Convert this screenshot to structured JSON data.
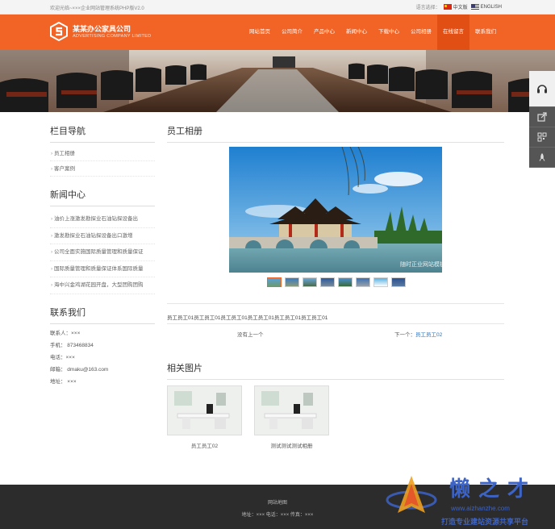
{
  "topbar": {
    "welcome": "欢迎光临~×××企业网站管理系统PHP版V2.0",
    "language_label": "语言选择：",
    "lang_cn": "中文版",
    "lang_en": "ENGLISH"
  },
  "header": {
    "company_name": "某某办公家具公司",
    "company_sub": "ADVERTISING COMPANY LIMITED",
    "nav": [
      "网站首页",
      "公司简介",
      "产品中心",
      "新闻中心",
      "下载中心",
      "公司相册",
      "在线留言",
      "联系我们"
    ],
    "active_nav": "在线留言"
  },
  "sidebar": {
    "nav_title": "栏目导航",
    "nav_items": [
      "员工相册",
      "客户案例"
    ],
    "news_title": "新闻中心",
    "news_items": [
      "油价上涨激发勘探业石油钻探设备出",
      "激发勘探业石油钻探设备出口激增",
      "公司全面实施国际质量管理和质量保证",
      "国际质量管理和质量保证体系国际质量",
      "海中兴金鸡湖花园开盘，大型团购团购"
    ],
    "contact_title": "联系我们",
    "contact": {
      "person": "联系人：×××",
      "mobile": "手机： 873468834",
      "phone": "电话：×××",
      "email": "邮箱： dmaku@163.com",
      "address": "地址： ×××"
    }
  },
  "main": {
    "title": "员工相册",
    "photo_watermark": "随时正业网站模板",
    "thumb_count": 8,
    "description": "员工员工01员工员工01员工员工01员工员工01员工员工01员工员工01",
    "prev_label": "没有上一个",
    "next_label": "下一个：",
    "next_link": "员工员工02",
    "related_title": "相关图片",
    "related": [
      {
        "caption": "员工员工02"
      },
      {
        "caption": "测试测试测试相册"
      }
    ]
  },
  "footer": {
    "sitemap": "网站地图",
    "address_line": "地址：×××  电话：×××  传真：×××"
  },
  "watermark": {
    "brand": "懒之才",
    "site": "www.aizhanzhe.com",
    "slogan": "打造专业建站资源共享平台"
  },
  "colors": {
    "accent": "#f26326",
    "link": "#2a6fb8",
    "footer": "#2c2c2c"
  }
}
